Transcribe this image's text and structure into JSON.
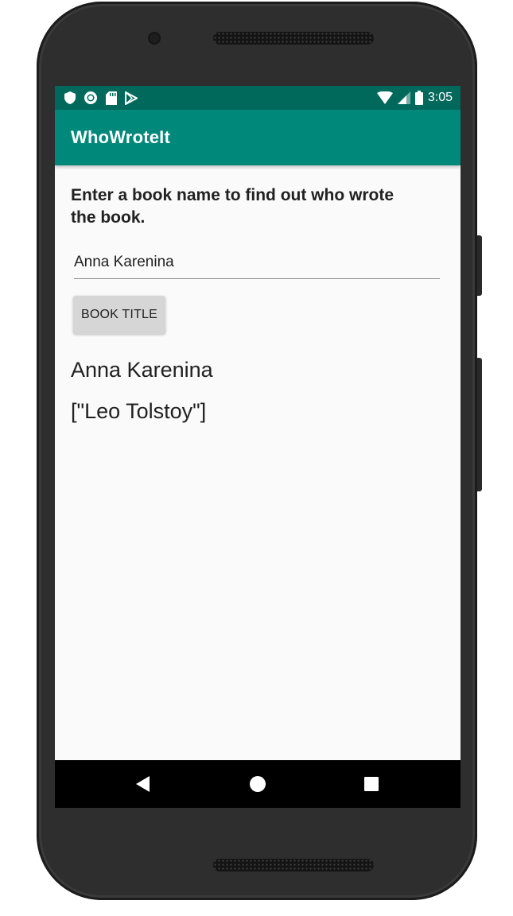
{
  "status_bar": {
    "time": "3:05",
    "left_icons": [
      "shield-icon",
      "sync-icon",
      "sd-card-icon",
      "play-store-icon"
    ],
    "right_icons": [
      "wifi-icon",
      "signal-icon",
      "battery-icon"
    ]
  },
  "app_bar": {
    "title": "WhoWroteIt"
  },
  "main": {
    "instructions": "Enter a book name to find out who wrote the book.",
    "book_input": {
      "value": "Anna Karenina"
    },
    "search_button_label": "BOOK TITLE",
    "result_title": "Anna Karenina",
    "result_author": "[\"Leo Tolstoy\"]"
  },
  "nav_bar": {
    "icons": [
      "back-icon",
      "home-icon",
      "recents-icon"
    ]
  },
  "colors": {
    "status_bar": "#00695c",
    "app_bar": "#00897b",
    "background": "#fafafa",
    "button": "#d6d6d6"
  }
}
